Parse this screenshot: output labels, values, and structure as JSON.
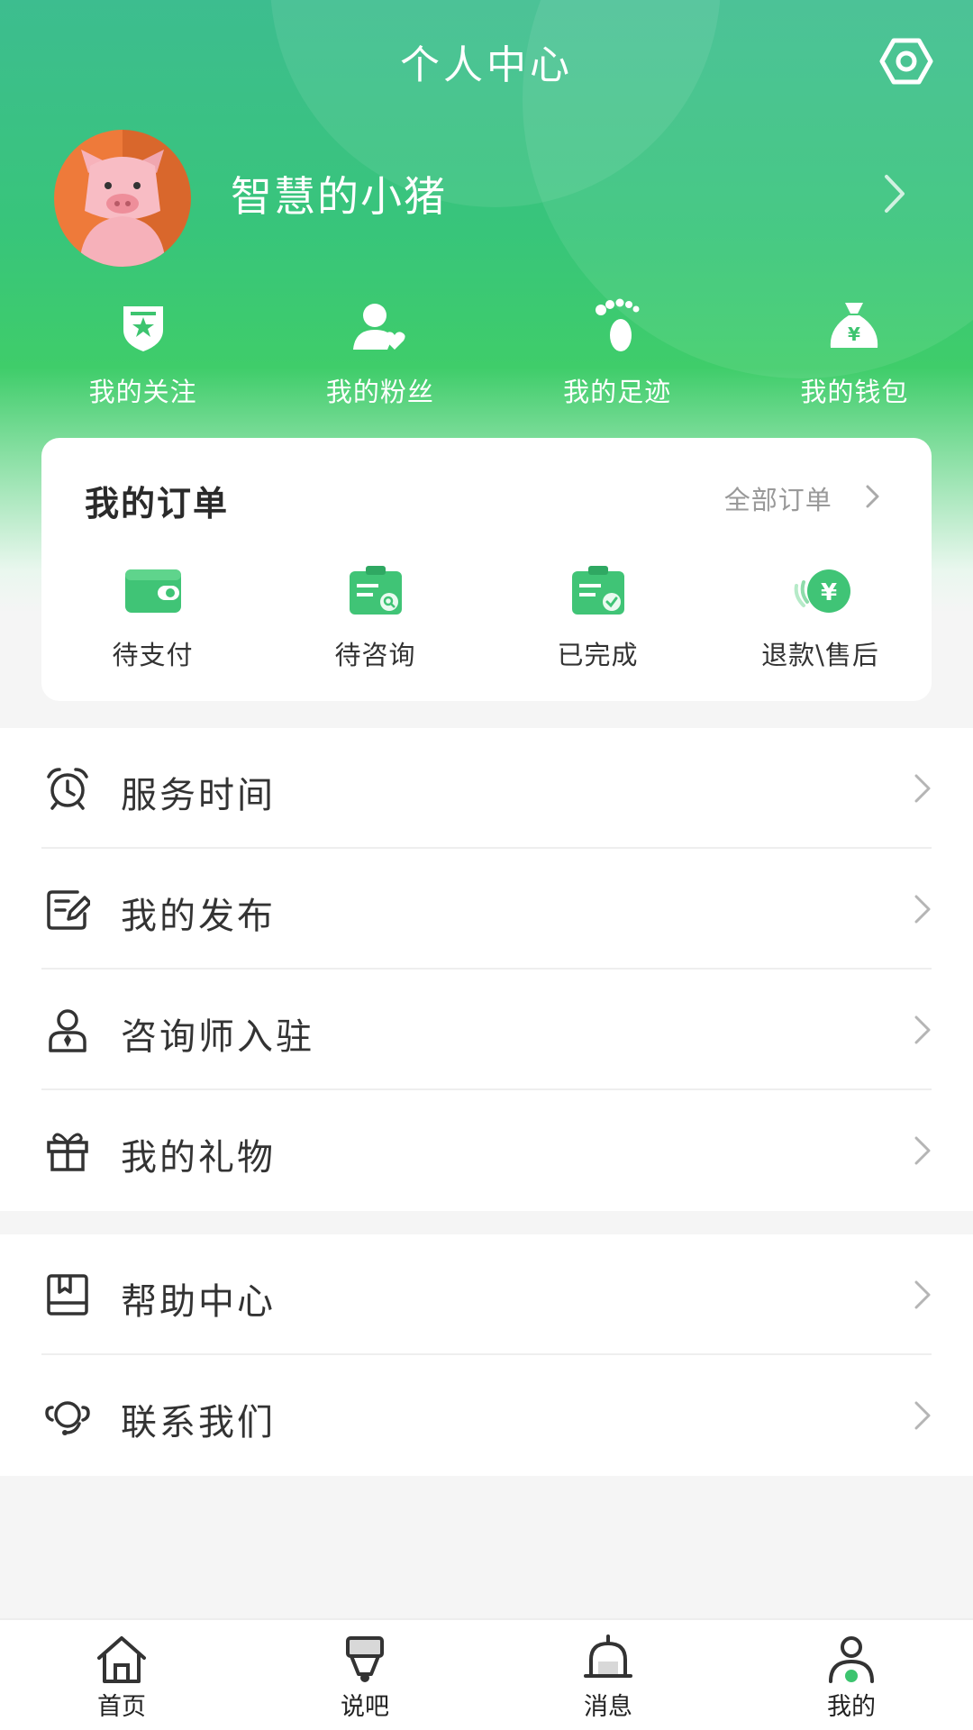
{
  "header": {
    "title": "个人中心",
    "settings_icon": "settings-hexagon-icon"
  },
  "profile": {
    "username": "智慧的小猪",
    "avatar_icon": "pig-avatar"
  },
  "quick_links": [
    {
      "label": "我的关注",
      "icon": "shield-star-icon"
    },
    {
      "label": "我的粉丝",
      "icon": "user-heart-icon"
    },
    {
      "label": "我的足迹",
      "icon": "footprint-icon"
    },
    {
      "label": "我的钱包",
      "icon": "money-bag-icon"
    }
  ],
  "orders": {
    "title": "我的订单",
    "all_label": "全部订单",
    "items": [
      {
        "label": "待支付",
        "icon": "wallet-icon"
      },
      {
        "label": "待咨询",
        "icon": "clipboard-search-icon"
      },
      {
        "label": "已完成",
        "icon": "clipboard-check-icon"
      },
      {
        "label": "退款\\售后",
        "icon": "refund-yen-icon"
      }
    ]
  },
  "menu_group_1": [
    {
      "label": "服务时间",
      "icon": "alarm-clock-icon"
    },
    {
      "label": "我的发布",
      "icon": "edit-document-icon"
    },
    {
      "label": "咨询师入驻",
      "icon": "consultant-icon"
    },
    {
      "label": "我的礼物",
      "icon": "gift-icon"
    }
  ],
  "menu_group_2": [
    {
      "label": "帮助中心",
      "icon": "help-book-icon"
    },
    {
      "label": "联系我们",
      "icon": "headset-icon"
    }
  ],
  "tabbar": [
    {
      "label": "首页",
      "icon": "home-icon"
    },
    {
      "label": "说吧",
      "icon": "talk-icon"
    },
    {
      "label": "消息",
      "icon": "bell-icon"
    },
    {
      "label": "我的",
      "icon": "profile-icon",
      "active": true
    }
  ],
  "colors": {
    "brand_green": "#3dc46f",
    "accent_green": "#2fc46a"
  }
}
